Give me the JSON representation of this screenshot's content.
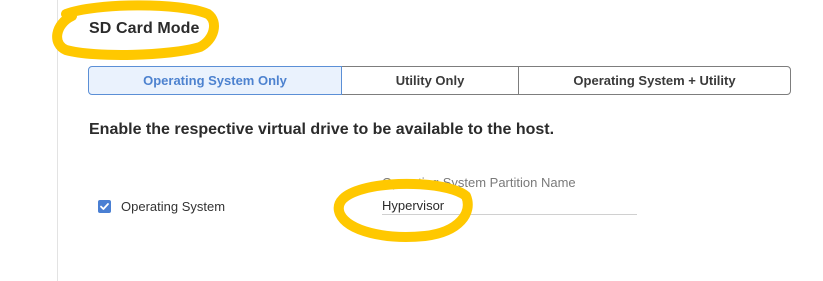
{
  "section": {
    "title": "SD Card Mode"
  },
  "mode_tabs": [
    {
      "label": "Operating System Only",
      "selected": true
    },
    {
      "label": "Utility Only",
      "selected": false
    },
    {
      "label": "Operating System + Utility",
      "selected": false
    }
  ],
  "description": "Enable the respective virtual drive to be available to the host.",
  "os_checkbox": {
    "label": "Operating System",
    "checked": true
  },
  "partition_field": {
    "label": "Operating System Partition Name",
    "value": "Hypervisor"
  },
  "colors": {
    "accent": "#4a7fd3",
    "selected_tab_bg": "#eaf2fd",
    "highlight_marker": "#ffc800"
  }
}
